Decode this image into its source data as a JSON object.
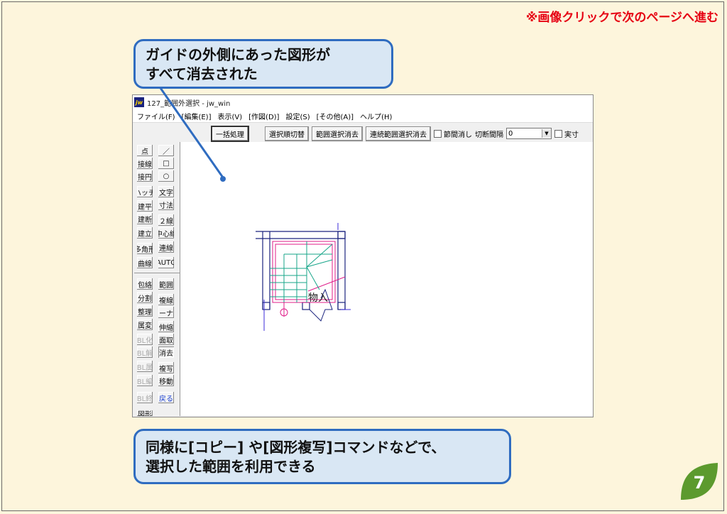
{
  "page": {
    "top_note": "※画像クリックで次のページへ進む",
    "callout_top": "ガイドの外側にあった図形が\nすべて消去された",
    "callout_bottom": "同様に[コピー] や[図形複写]コマンドなどで、\n選択した範囲を利用できる",
    "page_number": "7"
  },
  "window": {
    "title": "127_範囲外選択 - jw_win",
    "menu": [
      "ファイル(F)",
      "[編集(E)]",
      "表示(V)",
      "[作図(D)]",
      "設定(S)",
      "[その他(A)]",
      "ヘルプ(H)"
    ],
    "toolbar": {
      "batch": "一括処理",
      "toggle_order": "選択順切替",
      "range_delete": "範囲選択消去",
      "continuous_delete": "連続範囲選択消去",
      "node_delete": "節間消し",
      "interval_label": "切断間隔",
      "interval_value": "0",
      "actual_size": "実寸"
    },
    "sidebar": {
      "left": [
        "点",
        "接線",
        "接円",
        "ハッチ",
        "建平",
        "建断",
        "建立",
        "多角形",
        "曲線",
        "包絡",
        "分割",
        "整理",
        "属変",
        "BL化",
        "BL解",
        "BL属",
        "BL編",
        "BL終",
        "図形"
      ],
      "right": [
        "／",
        "□",
        "○",
        "文字",
        "寸法",
        "２線",
        "中心線",
        "連線",
        "AUTO",
        "範囲",
        "複線",
        "コーナー",
        "伸縮",
        "面取",
        "消去",
        "複写",
        "移動",
        "戻る"
      ]
    },
    "drawing": {
      "label": "物入"
    }
  },
  "colors": {
    "accent": "#e60012",
    "callout_border": "#2f6cc0",
    "callout_fill": "#d9e7f4",
    "leaf": "#5c9a2e"
  }
}
